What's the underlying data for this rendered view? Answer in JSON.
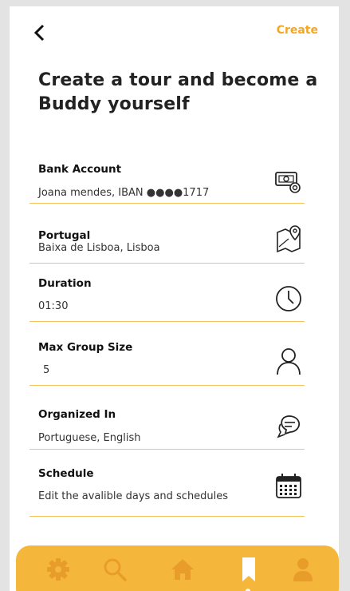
{
  "header": {
    "create_label": "Create"
  },
  "title": "Create a tour and become a Buddy yourself",
  "fields": {
    "bank": {
      "label": "Bank Account",
      "value": "Joana mendes, IBAN ●●●●1717"
    },
    "location": {
      "label": "Portugal",
      "value": "Baixa de Lisboa, Lisboa"
    },
    "duration": {
      "label": "Duration",
      "value": "01:30"
    },
    "group": {
      "label": "Max Group Size",
      "value": "5"
    },
    "organized": {
      "label": "Organized In",
      "value": "Portuguese, English"
    },
    "schedule": {
      "label": "Schedule",
      "value": "Edit the avalible days and schedules"
    }
  },
  "icons": {
    "bank": "money-card-icon",
    "location": "map-pin-icon",
    "duration": "clock-icon",
    "group": "person-icon",
    "organized": "chat-bubbles-icon",
    "schedule": "calendar-icon"
  },
  "nav": [
    "gear-icon",
    "search-icon",
    "home-icon",
    "bookmark-icon",
    "user-icon"
  ],
  "colors": {
    "accent": "#f5b73b",
    "accent_text": "#f5a623",
    "active_nav": "#ffffff"
  }
}
